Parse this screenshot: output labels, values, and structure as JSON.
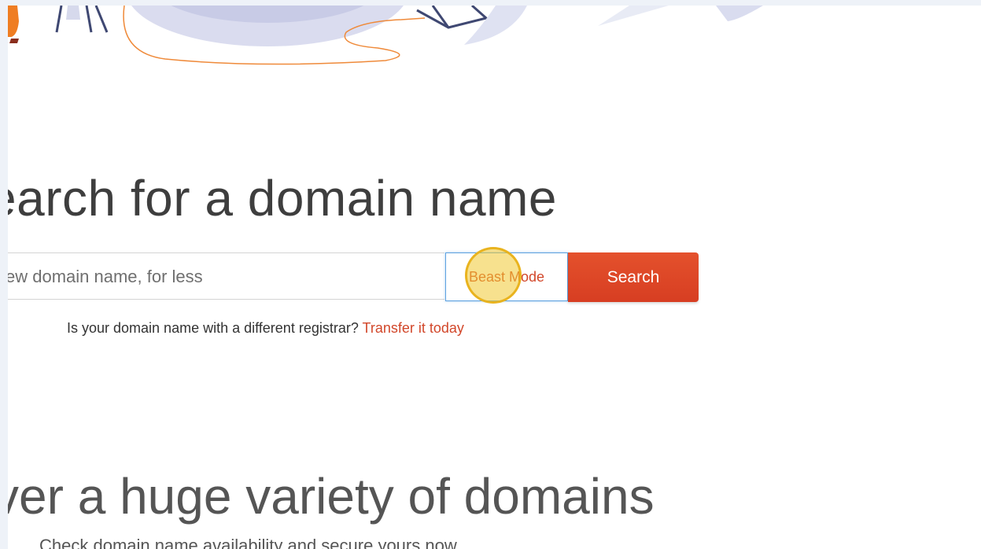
{
  "hero": {
    "illustration": "abstract-people-and-circles-illustration"
  },
  "search_section": {
    "headline": "earch for a domain name",
    "input": {
      "value": "",
      "placeholder": "ew domain name, for less"
    },
    "beast_mode_label": "Beast Mode",
    "search_button_label": "Search",
    "transfer_prompt": "Is your domain name with a different registrar?",
    "transfer_link_label": "Transfer it today"
  },
  "domains_section": {
    "headline": "ver a huge variety of domains",
    "subtext": "Check domain name availability and secure yours now"
  },
  "colors": {
    "accent": "#d2472a",
    "search_button": "#e04a2a",
    "beast_mode_border": "#5ea2e0",
    "background": "#eef2f8"
  }
}
